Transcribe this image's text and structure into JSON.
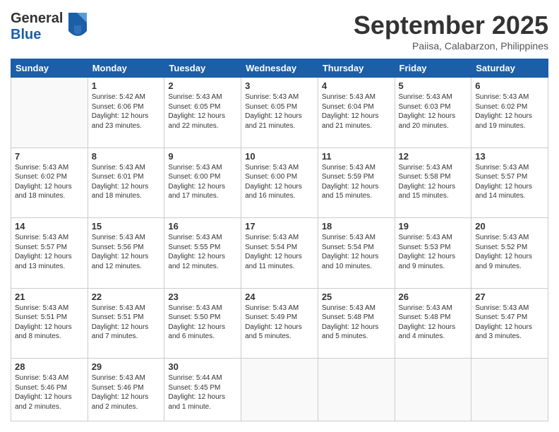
{
  "header": {
    "logo_line1": "General",
    "logo_line2": "Blue",
    "month": "September 2025",
    "location": "Paiisa, Calabarzon, Philippines"
  },
  "weekdays": [
    "Sunday",
    "Monday",
    "Tuesday",
    "Wednesday",
    "Thursday",
    "Friday",
    "Saturday"
  ],
  "weeks": [
    [
      {
        "day": "",
        "content": ""
      },
      {
        "day": "1",
        "content": "Sunrise: 5:42 AM\nSunset: 6:06 PM\nDaylight: 12 hours\nand 23 minutes."
      },
      {
        "day": "2",
        "content": "Sunrise: 5:43 AM\nSunset: 6:05 PM\nDaylight: 12 hours\nand 22 minutes."
      },
      {
        "day": "3",
        "content": "Sunrise: 5:43 AM\nSunset: 6:05 PM\nDaylight: 12 hours\nand 21 minutes."
      },
      {
        "day": "4",
        "content": "Sunrise: 5:43 AM\nSunset: 6:04 PM\nDaylight: 12 hours\nand 21 minutes."
      },
      {
        "day": "5",
        "content": "Sunrise: 5:43 AM\nSunset: 6:03 PM\nDaylight: 12 hours\nand 20 minutes."
      },
      {
        "day": "6",
        "content": "Sunrise: 5:43 AM\nSunset: 6:02 PM\nDaylight: 12 hours\nand 19 minutes."
      }
    ],
    [
      {
        "day": "7",
        "content": "Sunrise: 5:43 AM\nSunset: 6:02 PM\nDaylight: 12 hours\nand 18 minutes."
      },
      {
        "day": "8",
        "content": "Sunrise: 5:43 AM\nSunset: 6:01 PM\nDaylight: 12 hours\nand 18 minutes."
      },
      {
        "day": "9",
        "content": "Sunrise: 5:43 AM\nSunset: 6:00 PM\nDaylight: 12 hours\nand 17 minutes."
      },
      {
        "day": "10",
        "content": "Sunrise: 5:43 AM\nSunset: 6:00 PM\nDaylight: 12 hours\nand 16 minutes."
      },
      {
        "day": "11",
        "content": "Sunrise: 5:43 AM\nSunset: 5:59 PM\nDaylight: 12 hours\nand 15 minutes."
      },
      {
        "day": "12",
        "content": "Sunrise: 5:43 AM\nSunset: 5:58 PM\nDaylight: 12 hours\nand 15 minutes."
      },
      {
        "day": "13",
        "content": "Sunrise: 5:43 AM\nSunset: 5:57 PM\nDaylight: 12 hours\nand 14 minutes."
      }
    ],
    [
      {
        "day": "14",
        "content": "Sunrise: 5:43 AM\nSunset: 5:57 PM\nDaylight: 12 hours\nand 13 minutes."
      },
      {
        "day": "15",
        "content": "Sunrise: 5:43 AM\nSunset: 5:56 PM\nDaylight: 12 hours\nand 12 minutes."
      },
      {
        "day": "16",
        "content": "Sunrise: 5:43 AM\nSunset: 5:55 PM\nDaylight: 12 hours\nand 12 minutes."
      },
      {
        "day": "17",
        "content": "Sunrise: 5:43 AM\nSunset: 5:54 PM\nDaylight: 12 hours\nand 11 minutes."
      },
      {
        "day": "18",
        "content": "Sunrise: 5:43 AM\nSunset: 5:54 PM\nDaylight: 12 hours\nand 10 minutes."
      },
      {
        "day": "19",
        "content": "Sunrise: 5:43 AM\nSunset: 5:53 PM\nDaylight: 12 hours\nand 9 minutes."
      },
      {
        "day": "20",
        "content": "Sunrise: 5:43 AM\nSunset: 5:52 PM\nDaylight: 12 hours\nand 9 minutes."
      }
    ],
    [
      {
        "day": "21",
        "content": "Sunrise: 5:43 AM\nSunset: 5:51 PM\nDaylight: 12 hours\nand 8 minutes."
      },
      {
        "day": "22",
        "content": "Sunrise: 5:43 AM\nSunset: 5:51 PM\nDaylight: 12 hours\nand 7 minutes."
      },
      {
        "day": "23",
        "content": "Sunrise: 5:43 AM\nSunset: 5:50 PM\nDaylight: 12 hours\nand 6 minutes."
      },
      {
        "day": "24",
        "content": "Sunrise: 5:43 AM\nSunset: 5:49 PM\nDaylight: 12 hours\nand 5 minutes."
      },
      {
        "day": "25",
        "content": "Sunrise: 5:43 AM\nSunset: 5:48 PM\nDaylight: 12 hours\nand 5 minutes."
      },
      {
        "day": "26",
        "content": "Sunrise: 5:43 AM\nSunset: 5:48 PM\nDaylight: 12 hours\nand 4 minutes."
      },
      {
        "day": "27",
        "content": "Sunrise: 5:43 AM\nSunset: 5:47 PM\nDaylight: 12 hours\nand 3 minutes."
      }
    ],
    [
      {
        "day": "28",
        "content": "Sunrise: 5:43 AM\nSunset: 5:46 PM\nDaylight: 12 hours\nand 2 minutes."
      },
      {
        "day": "29",
        "content": "Sunrise: 5:43 AM\nSunset: 5:46 PM\nDaylight: 12 hours\nand 2 minutes."
      },
      {
        "day": "30",
        "content": "Sunrise: 5:44 AM\nSunset: 5:45 PM\nDaylight: 12 hours\nand 1 minute."
      },
      {
        "day": "",
        "content": ""
      },
      {
        "day": "",
        "content": ""
      },
      {
        "day": "",
        "content": ""
      },
      {
        "day": "",
        "content": ""
      }
    ]
  ]
}
